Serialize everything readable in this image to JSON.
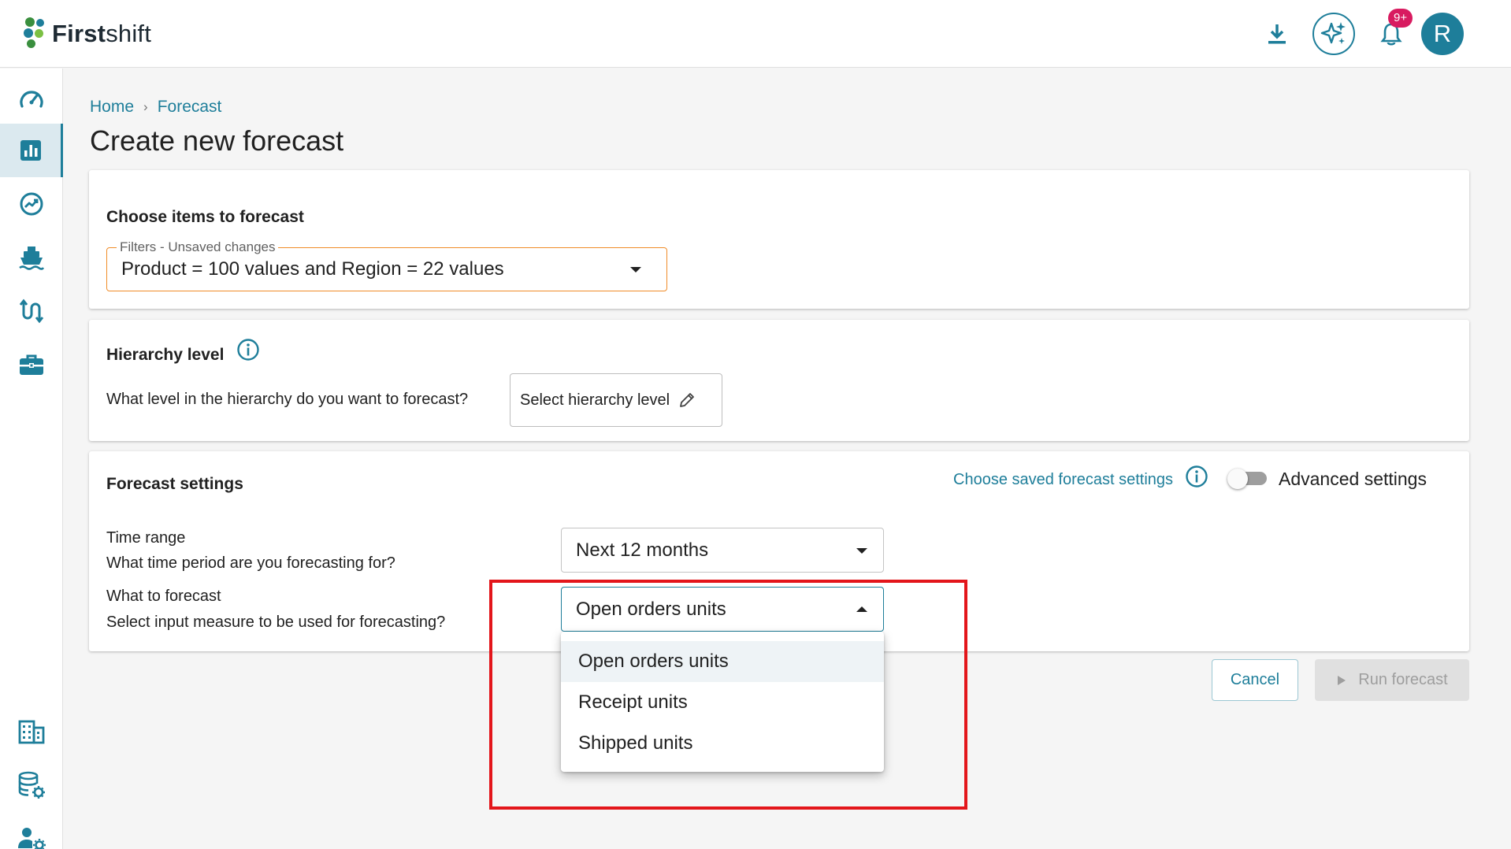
{
  "app": {
    "logo_bold": "First",
    "logo_regular": "shift"
  },
  "header": {
    "notification_badge": "9+",
    "avatar_initial": "R"
  },
  "sidebar": {
    "items": [
      {
        "icon": "speedometer-icon"
      },
      {
        "icon": "bar-chart-icon",
        "active": true
      },
      {
        "icon": "trend-line-icon"
      },
      {
        "icon": "ship-icon"
      },
      {
        "icon": "flow-arrows-icon"
      },
      {
        "icon": "briefcase-icon"
      },
      {
        "icon": "building-icon"
      },
      {
        "icon": "database-settings-icon"
      },
      {
        "icon": "user-settings-icon"
      }
    ]
  },
  "breadcrumb": {
    "home": "Home",
    "separator": "›",
    "current": "Forecast"
  },
  "page_title": "Create new forecast",
  "items_section": {
    "title": "Choose items to forecast",
    "filter_legend": "Filters - Unsaved changes",
    "filter_value": "Product = 100 values and Region = 22 values"
  },
  "hierarchy_section": {
    "title": "Hierarchy level",
    "question": "What level in the hierarchy do you want to forecast?",
    "button_label": "Select hierarchy level"
  },
  "settings_section": {
    "title": "Forecast settings",
    "saved_settings_link": "Choose saved forecast settings",
    "advanced_label": "Advanced settings",
    "advanced_enabled": false,
    "time_range_label": "Time range",
    "time_range_help": "What time period are you forecasting for?",
    "time_range_value": "Next 12 months",
    "what_label": "What to forecast",
    "what_help": "Select input measure to be used for forecasting?",
    "what_value": "Open orders units",
    "what_options": [
      "Open orders units",
      "Receipt units",
      "Shipped units"
    ]
  },
  "actions": {
    "cancel": "Cancel",
    "run": "Run forecast"
  },
  "colors": {
    "accent": "#1e7e9a",
    "filter_border": "#f08c28",
    "highlight": "#e3161b"
  }
}
